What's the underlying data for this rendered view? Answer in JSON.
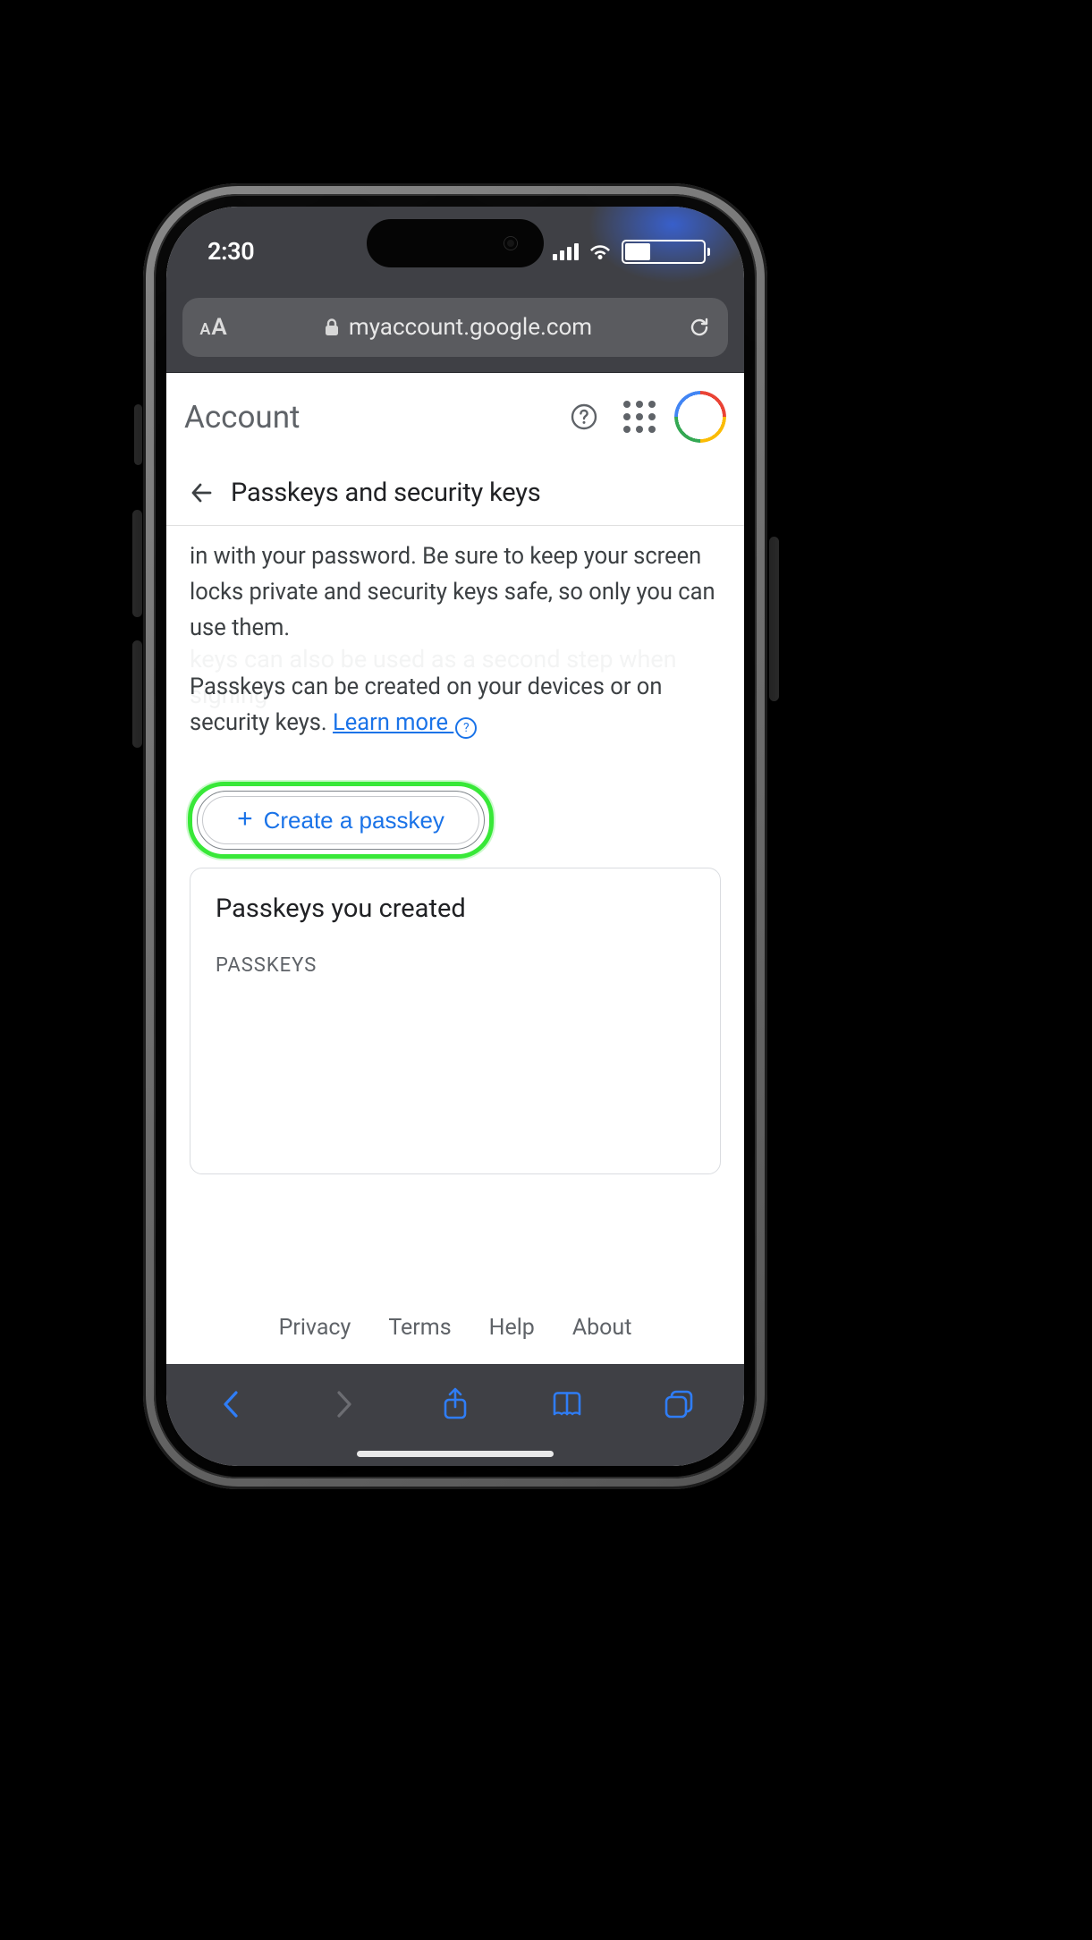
{
  "status": {
    "time": "2:30"
  },
  "browser": {
    "address": "myaccount.google.com",
    "text_size_label": "A"
  },
  "header": {
    "app_title": "Account"
  },
  "subheader": {
    "title": "Passkeys and security keys"
  },
  "content": {
    "paragraph1": "in with your password. Be sure to keep your screen locks private and security keys safe, so only you can use them.",
    "paragraph2_lead": "Passkeys can be created on your devices or on security keys. ",
    "learn_more": "Learn more",
    "ghost_text": "keys can also be used as a second step when signing",
    "create_button": "Create a passkey"
  },
  "card": {
    "heading": "Passkeys you created",
    "section_label": "PASSKEYS"
  },
  "footer": {
    "privacy": "Privacy",
    "terms": "Terms",
    "help": "Help",
    "about": "About"
  }
}
